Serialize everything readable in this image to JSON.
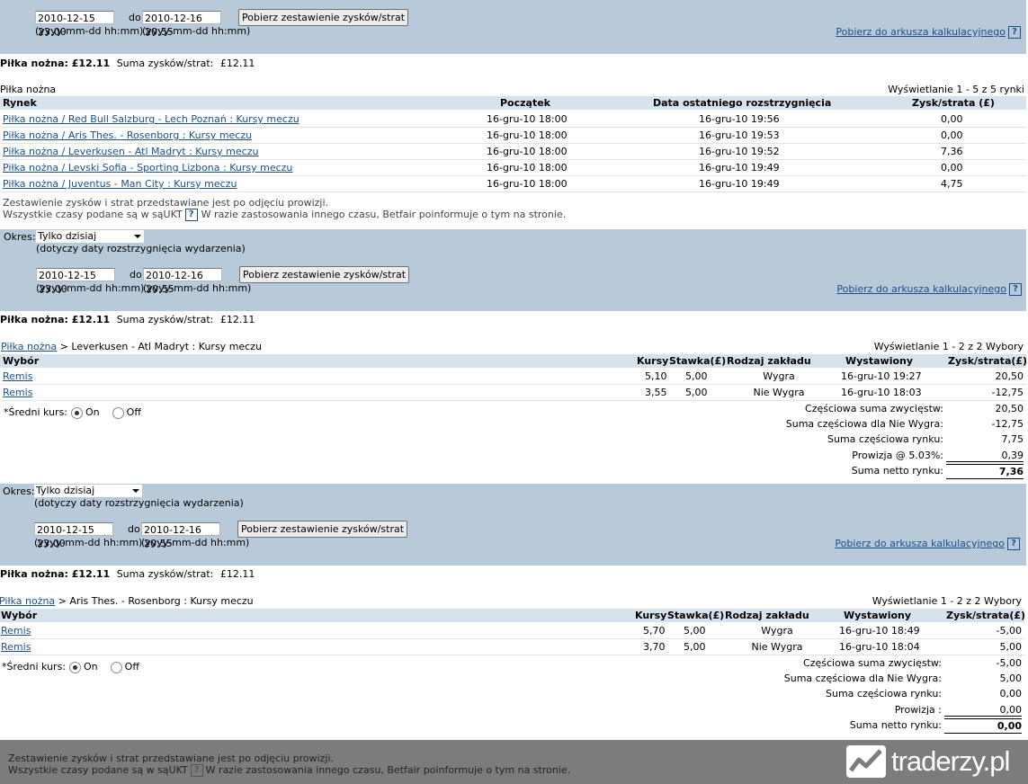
{
  "date_format": "(yyyy-mm-dd hh:mm)",
  "date_from": "2010-12-15 23:00",
  "date_to": "2010-12-16 20:55",
  "do_label": "do",
  "fetch_button": "Pobierz zestawienie zysków/strat",
  "spreadsheet_link": "Pobierz do arkusza kalkulacyjnego",
  "help_glyph": "?",
  "okres_label": "Okres:",
  "okres_value": "Tylko dzisiaj",
  "okres_note": "(dotyczy daty rozstrzygnięcia wydarzenia)",
  "summary": {
    "sport_total": "Piłka nożna: £12.11",
    "sum_label": "Suma zysków/strat:",
    "sum_value": "£12.11"
  },
  "markets": {
    "section_title": "Piłka nożna",
    "display": "Wyświetlanie 1 - 5 z 5 rynki",
    "headers": [
      "Rynek",
      "Początek",
      "Data ostatniego rozstrzygnięcia",
      "Zysk/strata (£)"
    ],
    "rows": [
      [
        "Piłka nożna / Red Bull Salzburg - Lech Poznań : Kursy meczu",
        "16-gru-10 18:00",
        "16-gru-10 19:56",
        "0,00"
      ],
      [
        "Piłka nożna / Aris Thes. - Rosenborg : Kursy meczu",
        "16-gru-10 18:00",
        "16-gru-10 19:53",
        "0,00"
      ],
      [
        "Piłka nożna / Leverkusen - Atl Madryt : Kursy meczu",
        "16-gru-10 18:00",
        "16-gru-10 19:52",
        "7,36"
      ],
      [
        "Piłka nożna / Levski Sofia - Sporting Lizbona : Kursy meczu",
        "16-gru-10 18:00",
        "16-gru-10 19:49",
        "0,00"
      ],
      [
        "Piłka nożna / Juventus - Man City : Kursy meczu",
        "16-gru-10 18:00",
        "16-gru-10 19:49",
        "4,75"
      ]
    ],
    "note1": "Zestawienie zysków i strat przedstawiane jest po odjęciu prowizji.",
    "note2a": "Wszystkie czasy podane są w sąUKT",
    "note2b": "W razie zastosowania innego czasu, Betfair poinformuje o tym na stronie."
  },
  "bet_headers": [
    "Wybór",
    "Kursy",
    "Stawka(£)",
    "Rodzaj zakładu",
    "Wystawiony",
    "Zysk/strata(£)"
  ],
  "avg_label": "*Średni kurs:",
  "on_label": "On",
  "off_label": "Off",
  "crumb_link": "Piłka nożna",
  "detail1": {
    "crumb_rest": "> Leverkusen - Atl Madryt : Kursy meczu",
    "display": "Wyświetlanie 1 - 2 z 2 Wybory",
    "rows": [
      [
        "Remis",
        "5,10",
        "5,00",
        "Wygra",
        "16-gru-10 19:27",
        "20,50"
      ],
      [
        "Remis",
        "3,55",
        "5,00",
        "Nie Wygra",
        "16-gru-10 18:03",
        "-12,75"
      ]
    ],
    "sums": [
      [
        "Częściowa suma zwycięstw:",
        "20,50"
      ],
      [
        "Suma częściowa dla Nie Wygra:",
        "-12,75"
      ],
      [
        "Suma częściowa rynku:",
        "7,75"
      ],
      [
        "Prowizja @ 5.03%:",
        "0,39"
      ],
      [
        "Suma netto rynku:",
        "7,36"
      ]
    ]
  },
  "detail2": {
    "crumb_rest": "> Aris Thes. - Rosenborg : Kursy meczu",
    "display": "Wyświetlanie 1 - 2 z 2 Wybory",
    "rows": [
      [
        "Remis",
        "5,70",
        "5,00",
        "Wygra",
        "16-gru-10 18:49",
        "-5,00"
      ],
      [
        "Remis",
        "3,70",
        "5,00",
        "Nie Wygra",
        "16-gru-10 18:04",
        "5,00"
      ]
    ],
    "sums": [
      [
        "Częściowa suma zwycięstw:",
        "-5,00"
      ],
      [
        "Suma częściowa dla Nie Wygra:",
        "5,00"
      ],
      [
        "Suma częściowa rynku:",
        "0,00"
      ],
      [
        "Prowizja :",
        "0,00"
      ],
      [
        "Suma netto rynku:",
        "0,00"
      ]
    ]
  },
  "logo_text": "traderzy.pl",
  "colors": {
    "band": "#b8c9d9",
    "header": "#d6e2ec",
    "link": "#1b4f8a",
    "footer": "#7c7c7c"
  }
}
